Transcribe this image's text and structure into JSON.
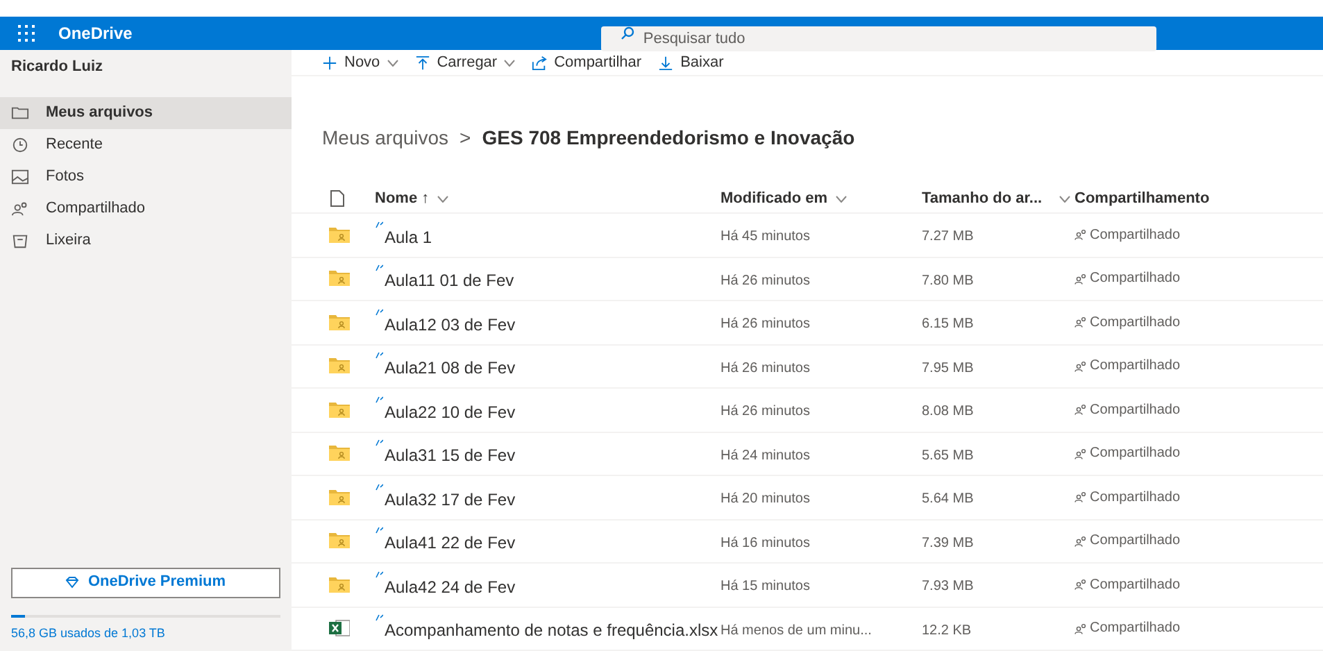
{
  "app": {
    "name": "OneDrive",
    "search_placeholder": "Pesquisar tudo"
  },
  "sidebar": {
    "user": "Ricardo Luiz",
    "items": [
      {
        "label": "Meus arquivos",
        "selected": true
      },
      {
        "label": "Recente",
        "selected": false
      },
      {
        "label": "Fotos",
        "selected": false
      },
      {
        "label": "Compartilhado",
        "selected": false
      },
      {
        "label": "Lixeira",
        "selected": false
      }
    ],
    "premium_button": "OneDrive Premium",
    "storage": {
      "level": 0.05,
      "text": "56,8 GB usados de 1,03 TB"
    }
  },
  "toolbar": [
    {
      "label": "Novo",
      "dropdown": true
    },
    {
      "label": "Carregar",
      "dropdown": true
    },
    {
      "label": "Compartilhar",
      "dropdown": false
    },
    {
      "label": "Baixar",
      "dropdown": false
    }
  ],
  "breadcrumb": {
    "parent": "Meus arquivos",
    "separator": ">",
    "current": "GES 708  Empreendedorismo e Inovação"
  },
  "table": {
    "columns": [
      {
        "label": "Nome ↑"
      },
      {
        "label": "Modificado em"
      },
      {
        "label": "Tamanho do ar..."
      },
      {
        "label": "Compartilhamento"
      }
    ],
    "rows": [
      {
        "kind": "folder",
        "name": "Aula 1",
        "modified": "Há 45 minutos",
        "size": "7.27 MB",
        "sharing": "Compartilhado"
      },
      {
        "kind": "folder",
        "name": "Aula11 01 de Fev",
        "modified": "Há 26 minutos",
        "size": "7.80 MB",
        "sharing": "Compartilhado"
      },
      {
        "kind": "folder",
        "name": "Aula12 03 de Fev",
        "modified": "Há 26 minutos",
        "size": "6.15 MB",
        "sharing": "Compartilhado"
      },
      {
        "kind": "folder",
        "name": "Aula21 08 de Fev",
        "modified": "Há 26 minutos",
        "size": "7.95 MB",
        "sharing": "Compartilhado"
      },
      {
        "kind": "folder",
        "name": "Aula22 10 de Fev",
        "modified": "Há 26 minutos",
        "size": "8.08 MB",
        "sharing": "Compartilhado"
      },
      {
        "kind": "folder",
        "name": "Aula31 15 de Fev",
        "modified": "Há 24 minutos",
        "size": "5.65 MB",
        "sharing": "Compartilhado"
      },
      {
        "kind": "folder",
        "name": "Aula32 17 de Fev",
        "modified": "Há 20 minutos",
        "size": "5.64 MB",
        "sharing": "Compartilhado"
      },
      {
        "kind": "folder",
        "name": "Aula41 22 de Fev",
        "modified": "Há 16 minutos",
        "size": "7.39 MB",
        "sharing": "Compartilhado"
      },
      {
        "kind": "folder",
        "name": "Aula42 24 de Fev",
        "modified": "Há 15 minutos",
        "size": "7.93 MB",
        "sharing": "Compartilhado"
      },
      {
        "kind": "excel",
        "name": "Acompanhamento de notas e frequência.xlsx",
        "modified": "Há menos de um minu...",
        "size": "12.2 KB",
        "sharing": "Compartilhado"
      }
    ]
  }
}
